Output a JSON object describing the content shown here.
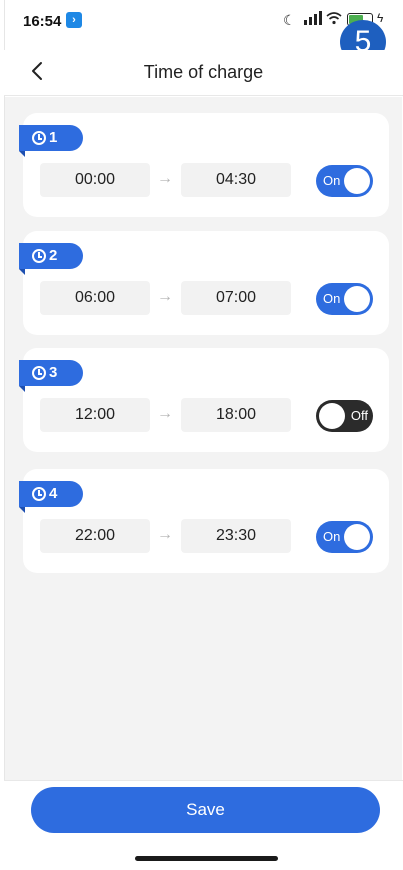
{
  "status_bar": {
    "time": "16:54",
    "app_badge_icon": "app-notification-icon",
    "step_number": "5"
  },
  "header": {
    "title": "Time of charge",
    "back_icon": "chevron-left-icon"
  },
  "slots": [
    {
      "number": "1",
      "start": "00:00",
      "end": "04:30",
      "enabled": true,
      "toggle_label": "On"
    },
    {
      "number": "2",
      "start": "06:00",
      "end": "07:00",
      "enabled": true,
      "toggle_label": "On"
    },
    {
      "number": "3",
      "start": "12:00",
      "end": "18:00",
      "enabled": false,
      "toggle_label": "Off"
    },
    {
      "number": "4",
      "start": "22:00",
      "end": "23:30",
      "enabled": true,
      "toggle_label": "On"
    }
  ],
  "arrow_glyph": "→",
  "footer": {
    "save_label": "Save"
  },
  "colors": {
    "accent": "#2e6cdf",
    "toggle_off": "#2b2b2b",
    "page_bg": "#f3f3f3"
  }
}
